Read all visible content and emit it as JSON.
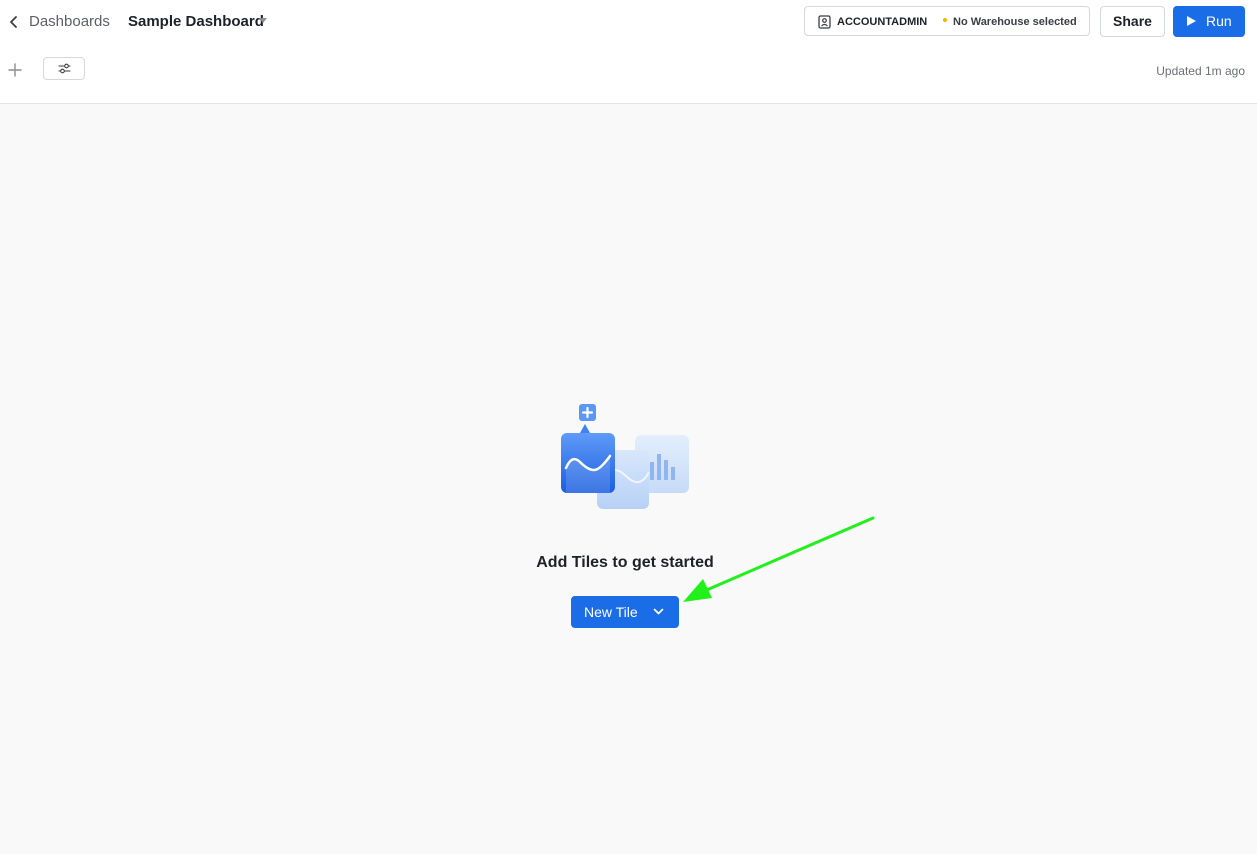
{
  "header": {
    "breadcrumb": "Dashboards",
    "title": "Sample Dashboard",
    "role": "ACCOUNTADMIN",
    "warehouse": "No Warehouse selected",
    "share_label": "Share",
    "run_label": "Run",
    "updated": "Updated 1m ago"
  },
  "empty_state": {
    "title": "Add Tiles to get started",
    "new_tile_label": "New Tile"
  },
  "colors": {
    "primary": "#1a6ce7",
    "warning_dot": "#f5b400",
    "annotation_arrow": "#22f01b"
  },
  "icons": {
    "back": "chevron-left-icon",
    "title_dropdown": "caret-down-icon",
    "role": "role-badge-icon",
    "run": "play-icon",
    "add": "plus-icon",
    "filter": "sliders-icon",
    "new_tile_dropdown": "chevron-down-icon"
  }
}
